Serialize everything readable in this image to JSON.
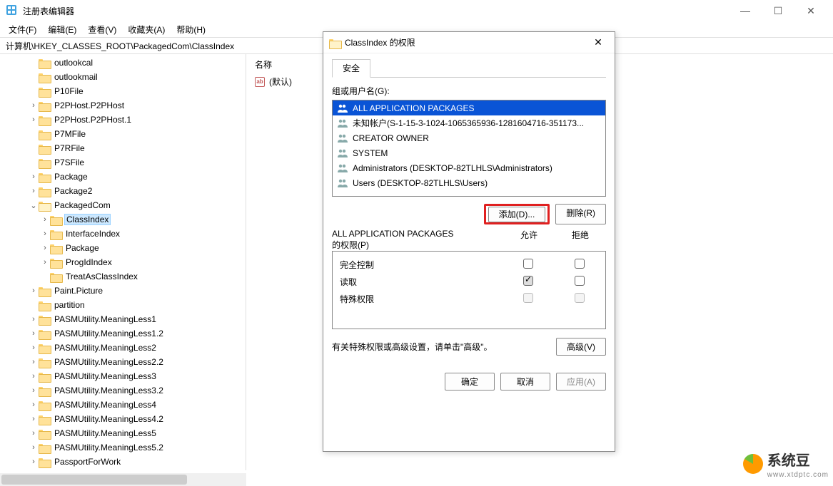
{
  "window": {
    "title": "注册表编辑器",
    "controls": {
      "min": "—",
      "max": "☐",
      "close": "✕"
    }
  },
  "menu": {
    "file": "文件(F)",
    "edit": "编辑(E)",
    "view": "查看(V)",
    "fav": "收藏夹(A)",
    "help": "帮助(H)"
  },
  "address": "计算机\\HKEY_CLASSES_ROOT\\PackagedCom\\ClassIndex",
  "list": {
    "header_name": "名称",
    "default_value": "(默认)"
  },
  "tree": {
    "items": [
      {
        "label": "outlookcal",
        "depth": 2,
        "exp": ""
      },
      {
        "label": "outlookmail",
        "depth": 2,
        "exp": ""
      },
      {
        "label": "P10File",
        "depth": 2,
        "exp": ""
      },
      {
        "label": "P2PHost.P2PHost",
        "depth": 2,
        "exp": ">"
      },
      {
        "label": "P2PHost.P2PHost.1",
        "depth": 2,
        "exp": ">"
      },
      {
        "label": "P7MFile",
        "depth": 2,
        "exp": ""
      },
      {
        "label": "P7RFile",
        "depth": 2,
        "exp": ""
      },
      {
        "label": "P7SFile",
        "depth": 2,
        "exp": ""
      },
      {
        "label": "Package",
        "depth": 2,
        "exp": ">"
      },
      {
        "label": "Package2",
        "depth": 2,
        "exp": ">"
      },
      {
        "label": "PackagedCom",
        "depth": 2,
        "exp": "v",
        "open": true
      },
      {
        "label": "ClassIndex",
        "depth": 3,
        "exp": ">",
        "sel": true
      },
      {
        "label": "InterfaceIndex",
        "depth": 3,
        "exp": ">"
      },
      {
        "label": "Package",
        "depth": 3,
        "exp": ">"
      },
      {
        "label": "ProgIdIndex",
        "depth": 3,
        "exp": ">"
      },
      {
        "label": "TreatAsClassIndex",
        "depth": 3,
        "exp": ""
      },
      {
        "label": "Paint.Picture",
        "depth": 2,
        "exp": ">"
      },
      {
        "label": "partition",
        "depth": 2,
        "exp": ""
      },
      {
        "label": "PASMUtility.MeaningLess1",
        "depth": 2,
        "exp": ">"
      },
      {
        "label": "PASMUtility.MeaningLess1.2",
        "depth": 2,
        "exp": ">"
      },
      {
        "label": "PASMUtility.MeaningLess2",
        "depth": 2,
        "exp": ">"
      },
      {
        "label": "PASMUtility.MeaningLess2.2",
        "depth": 2,
        "exp": ">"
      },
      {
        "label": "PASMUtility.MeaningLess3",
        "depth": 2,
        "exp": ">"
      },
      {
        "label": "PASMUtility.MeaningLess3.2",
        "depth": 2,
        "exp": ">"
      },
      {
        "label": "PASMUtility.MeaningLess4",
        "depth": 2,
        "exp": ">"
      },
      {
        "label": "PASMUtility.MeaningLess4.2",
        "depth": 2,
        "exp": ">"
      },
      {
        "label": "PASMUtility.MeaningLess5",
        "depth": 2,
        "exp": ">"
      },
      {
        "label": "PASMUtility.MeaningLess5.2",
        "depth": 2,
        "exp": ">"
      },
      {
        "label": "PassportForWork",
        "depth": 2,
        "exp": ">"
      }
    ]
  },
  "dialog": {
    "title": "ClassIndex 的权限",
    "tab_security": "安全",
    "group_label": "组或用户名(G):",
    "users": [
      {
        "name": "ALL APPLICATION PACKAGES",
        "sel": true,
        "icon": "group"
      },
      {
        "name": "未知帐户(S-1-15-3-1024-1065365936-1281604716-351173...",
        "icon": "group"
      },
      {
        "name": "CREATOR OWNER",
        "icon": "group"
      },
      {
        "name": "SYSTEM",
        "icon": "group"
      },
      {
        "name": "Administrators (DESKTOP-82TLHLS\\Administrators)",
        "icon": "group"
      },
      {
        "name": "Users (DESKTOP-82TLHLS\\Users)",
        "icon": "group"
      }
    ],
    "btn_add": "添加(D)...",
    "btn_remove": "删除(R)",
    "perm_title_line1": "ALL APPLICATION PACKAGES",
    "perm_title_line2": "的权限(P)",
    "col_allow": "允许",
    "col_deny": "拒绝",
    "perms": [
      {
        "name": "完全控制",
        "allow": "unchecked",
        "deny": "unchecked"
      },
      {
        "name": "读取",
        "allow": "checked-grey",
        "deny": "unchecked"
      },
      {
        "name": "特殊权限",
        "allow": "disabled",
        "deny": "disabled"
      }
    ],
    "adv_text": "有关特殊权限或高级设置，请单击\"高级\"。",
    "btn_adv": "高级(V)",
    "btn_ok": "确定",
    "btn_cancel": "取消",
    "btn_apply": "应用(A)"
  },
  "watermark": {
    "name": "系统豆",
    "url": "www.xtdptc.com"
  }
}
